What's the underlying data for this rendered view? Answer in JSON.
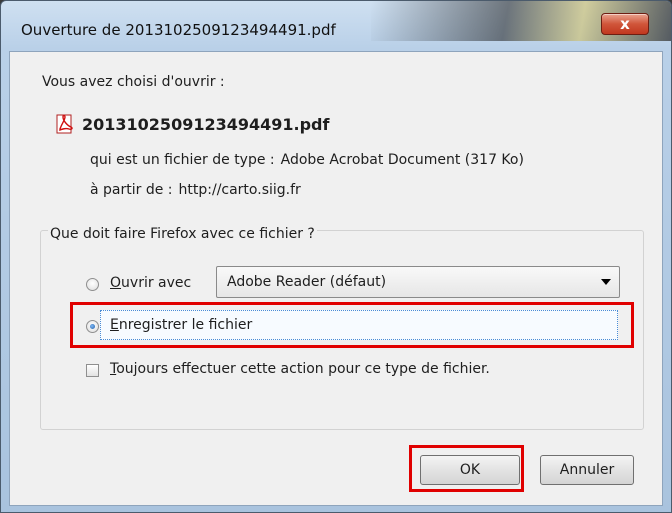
{
  "window": {
    "title": "Ouverture de 2013102509123494491.pdf",
    "close_label": "x"
  },
  "dialog": {
    "intro": "Vous avez choisi d'ouvrir :",
    "file_name": "2013102509123494491.pdf",
    "file_type_label": "qui est un fichier de type :",
    "file_type_value": "Adobe Acrobat Document (317 Ko)",
    "source_label": "à partir de :",
    "source_value": "http://carto.siig.fr"
  },
  "action_group": {
    "label": "Que doit faire Firefox avec ce fichier ?",
    "open_with_label_prefix": "O",
    "open_with_label_rest": "uvrir avec",
    "open_with_selected": "Adobe Reader  (défaut)",
    "save_label_prefix": "E",
    "save_label_rest": "nregistrer le fichier",
    "always_label_prefix": "T",
    "always_label_rest": "oujours effectuer cette action pour ce type de fichier.",
    "open_with_checked": false,
    "save_checked": true,
    "always_checked": false
  },
  "buttons": {
    "ok": "OK",
    "cancel": "Annuler"
  },
  "colors": {
    "highlight": "#e00000",
    "close_button": "#c1371f"
  }
}
